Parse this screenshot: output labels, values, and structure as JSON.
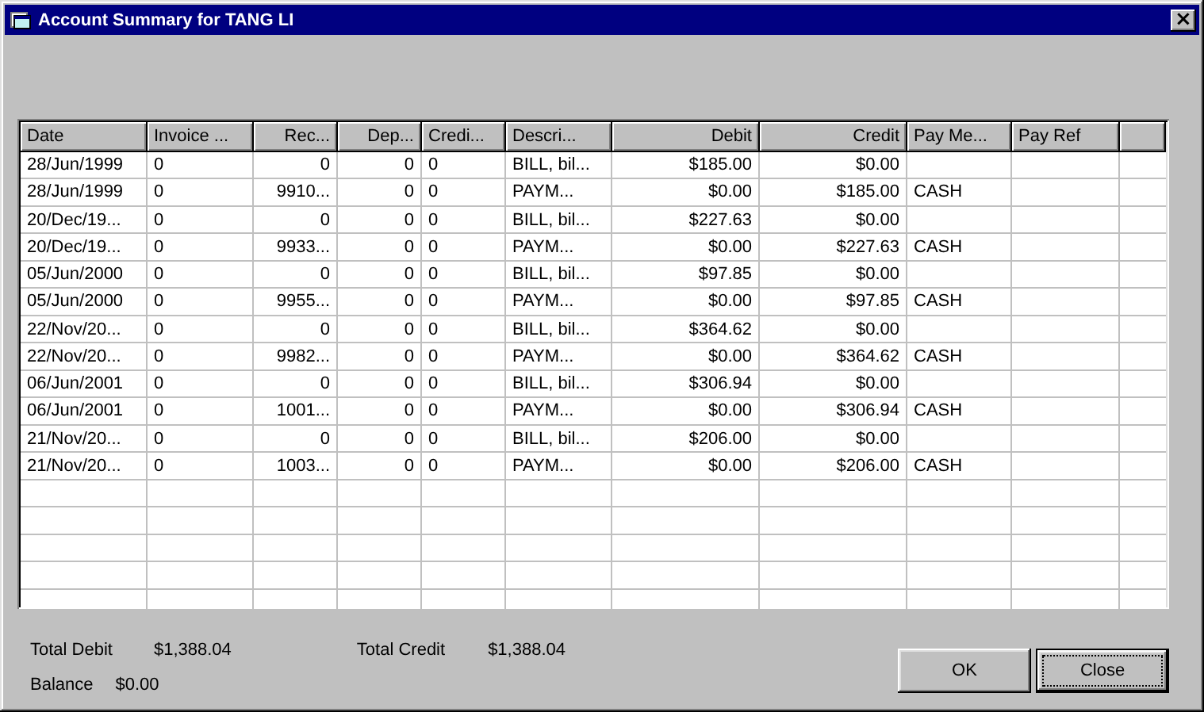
{
  "window": {
    "title": "Account Summary for TANG LI",
    "close_label": "×"
  },
  "table": {
    "columns": [
      "Date",
      "Invoice ...",
      "Rec...",
      "Dep...",
      "Credi...",
      "Descri...",
      "Debit",
      "Credit",
      "Pay Me...",
      "Pay Ref"
    ],
    "rows": [
      [
        "28/Jun/1999",
        "0",
        "0",
        "0",
        "0",
        "BILL, bil...",
        "$185.00",
        "$0.00",
        "",
        ""
      ],
      [
        "28/Jun/1999",
        "0",
        "9910...",
        "0",
        "0",
        "PAYM...",
        "$0.00",
        "$185.00",
        "CASH",
        ""
      ],
      [
        "20/Dec/19...",
        "0",
        "0",
        "0",
        "0",
        "BILL, bil...",
        "$227.63",
        "$0.00",
        "",
        ""
      ],
      [
        "20/Dec/19...",
        "0",
        "9933...",
        "0",
        "0",
        "PAYM...",
        "$0.00",
        "$227.63",
        "CASH",
        ""
      ],
      [
        "05/Jun/2000",
        "0",
        "0",
        "0",
        "0",
        "BILL, bil...",
        "$97.85",
        "$0.00",
        "",
        ""
      ],
      [
        "05/Jun/2000",
        "0",
        "9955...",
        "0",
        "0",
        "PAYM...",
        "$0.00",
        "$97.85",
        "CASH",
        ""
      ],
      [
        "22/Nov/20...",
        "0",
        "0",
        "0",
        "0",
        "BILL, bil...",
        "$364.62",
        "$0.00",
        "",
        ""
      ],
      [
        "22/Nov/20...",
        "0",
        "9982...",
        "0",
        "0",
        "PAYM...",
        "$0.00",
        "$364.62",
        "CASH",
        ""
      ],
      [
        "06/Jun/2001",
        "0",
        "0",
        "0",
        "0",
        "BILL, bil...",
        "$306.94",
        "$0.00",
        "",
        ""
      ],
      [
        "06/Jun/2001",
        "0",
        "1001...",
        "0",
        "0",
        "PAYM...",
        "$0.00",
        "$306.94",
        "CASH",
        ""
      ],
      [
        "21/Nov/20...",
        "0",
        "0",
        "0",
        "0",
        "BILL, bil...",
        "$206.00",
        "$0.00",
        "",
        ""
      ],
      [
        "21/Nov/20...",
        "0",
        "1003...",
        "0",
        "0",
        "PAYM...",
        "$0.00",
        "$206.00",
        "CASH",
        ""
      ]
    ]
  },
  "totals": {
    "total_debit_label": "Total Debit",
    "total_debit": "$1,388.04",
    "total_credit_label": "Total Credit",
    "total_credit": "$1,388.04",
    "balance_label": "Balance",
    "balance": "$0.00"
  },
  "buttons": [
    {
      "label": "OK",
      "focused": false
    },
    {
      "label": "Close",
      "focused": true
    }
  ]
}
